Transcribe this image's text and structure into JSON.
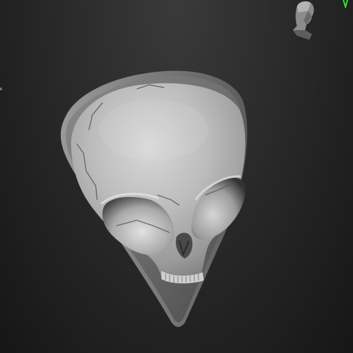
{
  "viewport": {
    "background_top": "#3a3a3a",
    "background_bottom": "#161616"
  },
  "model": {
    "icon": "alien-skull-guitar-pick-model",
    "material_color": "#b9b9b9"
  },
  "gizmo": {
    "icon": "head-navigation-gizmo"
  },
  "axis": {
    "icon": "green-axis-marker",
    "color": "#2ee82e"
  }
}
